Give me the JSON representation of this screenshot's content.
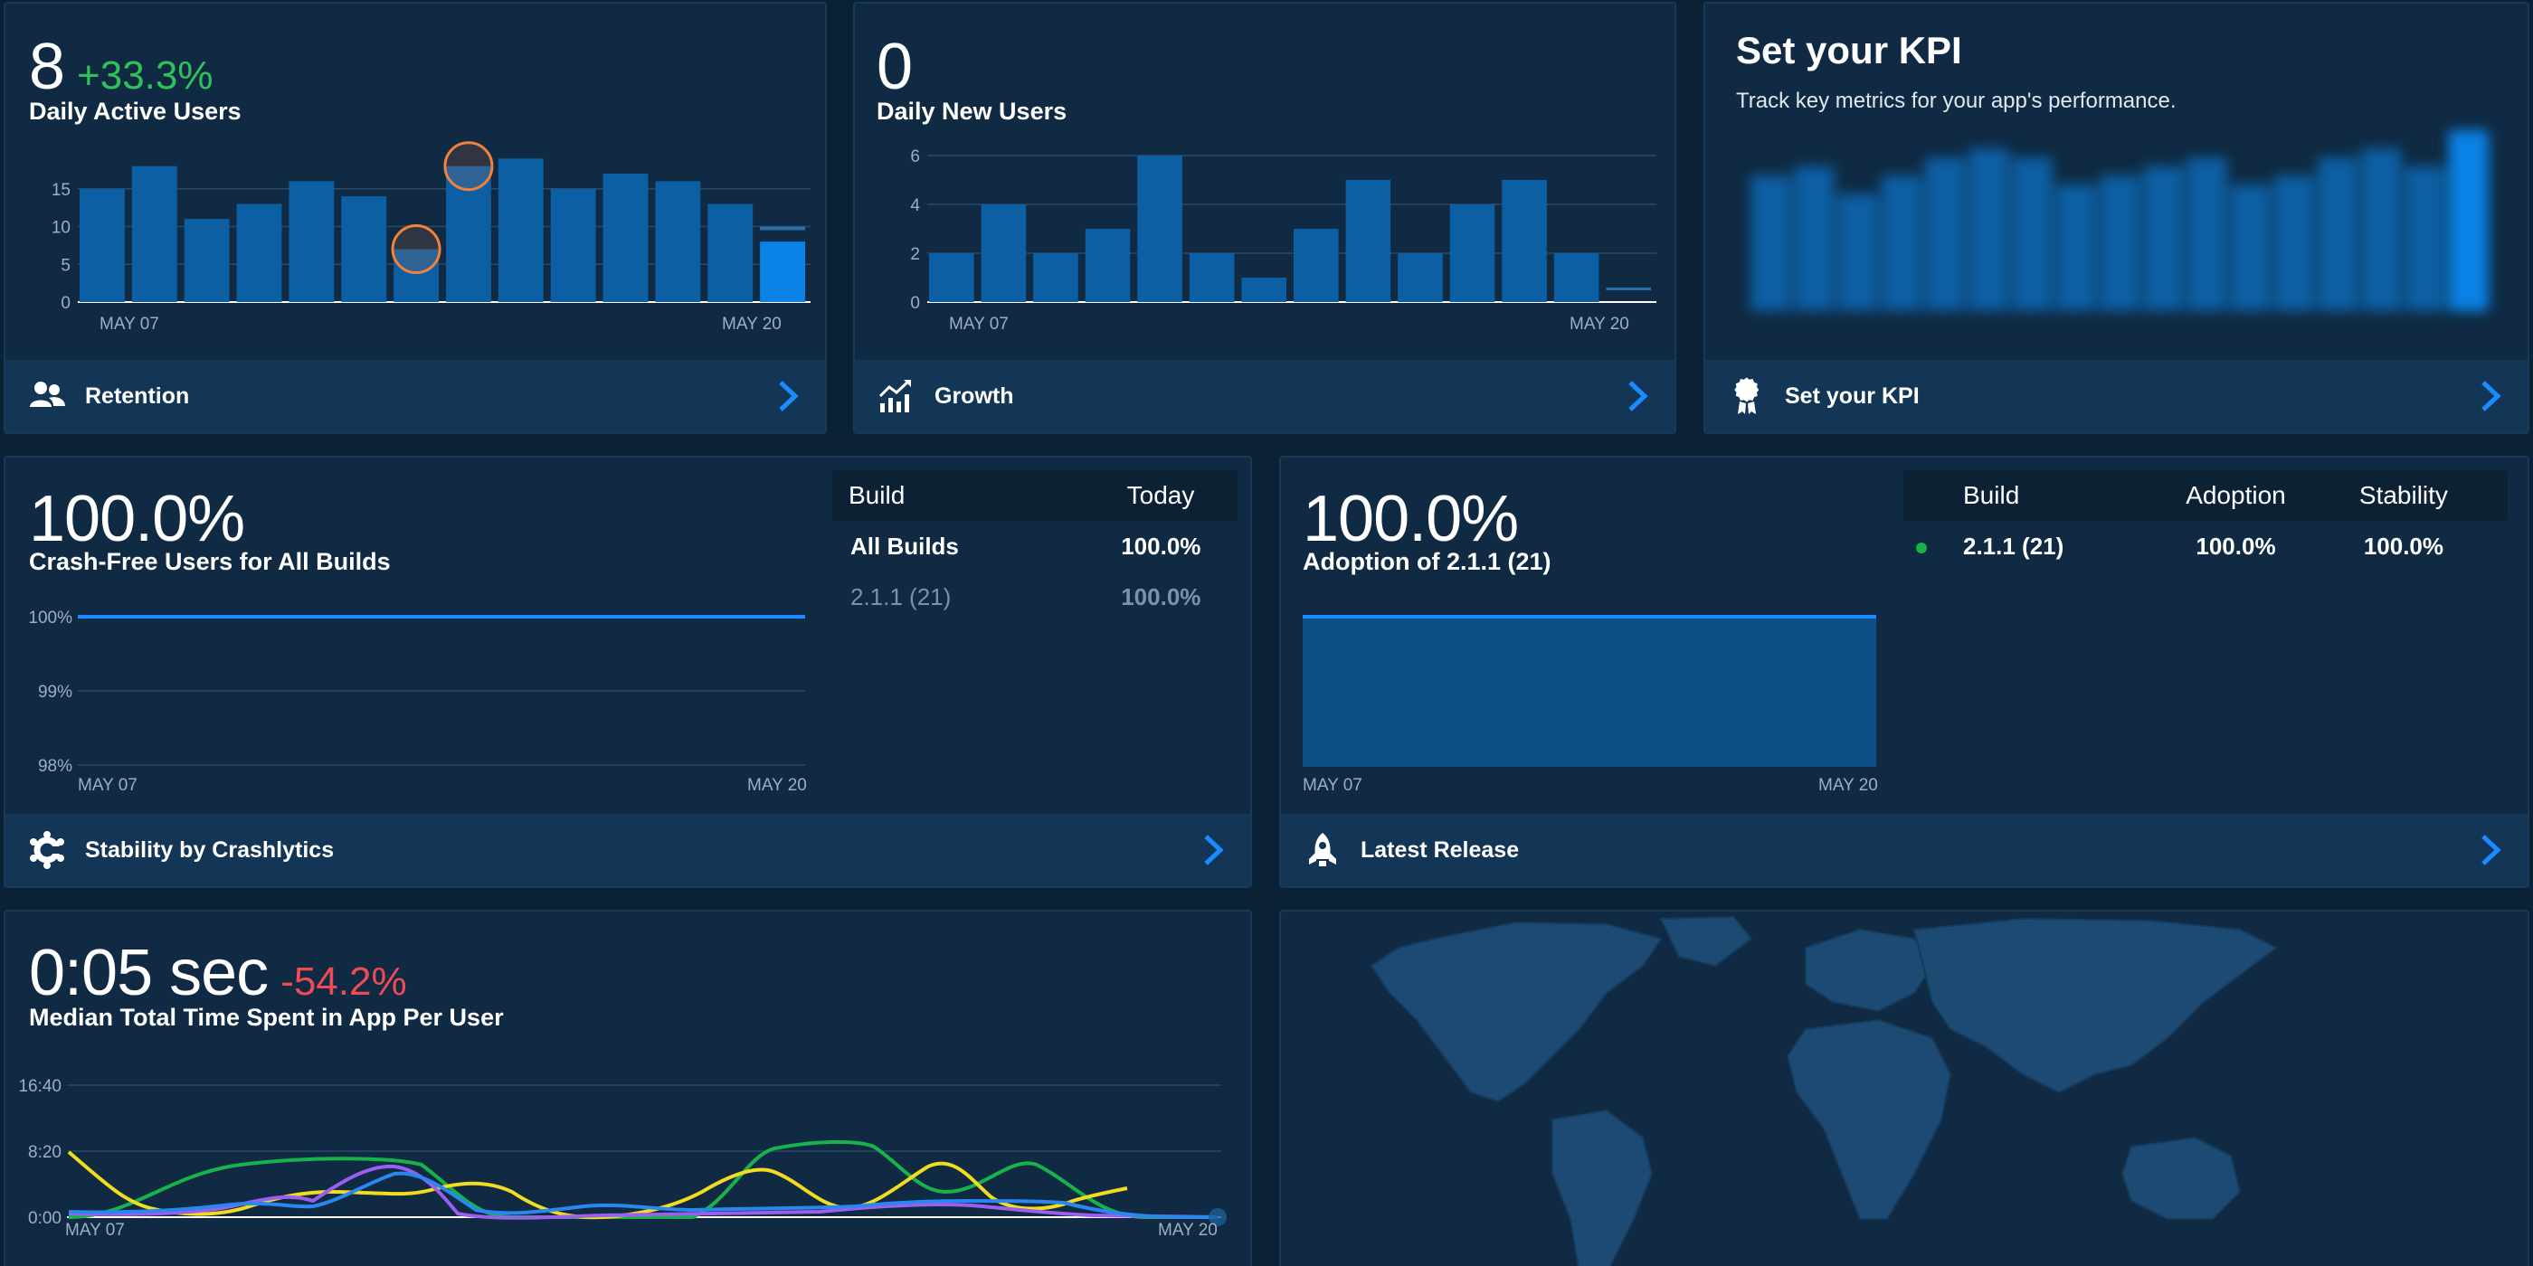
{
  "dau": {
    "value": "8",
    "delta": "+33.3%",
    "title": "Daily Active Users",
    "y_ticks": [
      "15",
      "10",
      "5",
      "0"
    ],
    "x_start": "MAY 07",
    "x_end": "MAY 20",
    "footer": "Retention"
  },
  "dnu": {
    "value": "0",
    "title": "Daily New Users",
    "y_ticks": [
      "6",
      "4",
      "2",
      "0"
    ],
    "x_start": "MAY 07",
    "x_end": "MAY 20",
    "footer": "Growth"
  },
  "kpi": {
    "title": "Set your KPI",
    "description": "Track key metrics for your app's performance.",
    "footer": "Set your KPI"
  },
  "crash": {
    "value": "100.0%",
    "title": "Crash-Free Users for All Builds",
    "y_ticks": [
      "100%",
      "99%",
      "98%"
    ],
    "x_start": "MAY 07",
    "x_end": "MAY 20",
    "table": {
      "headers": [
        "Build",
        "Today"
      ],
      "rows": [
        {
          "build": "All Builds",
          "today": "100.0%"
        },
        {
          "build": "2.1.1 (21)",
          "today": "100.0%"
        }
      ]
    },
    "footer": "Stability by Crashlytics"
  },
  "release": {
    "value": "100.0%",
    "title": "Adoption of 2.1.1 (21)",
    "x_start": "MAY 07",
    "x_end": "MAY 20",
    "table": {
      "headers": [
        "Build",
        "Adoption",
        "Stability"
      ],
      "rows": [
        {
          "build": "2.1.1 (21)",
          "adoption": "100.0%",
          "stability": "100.0%"
        }
      ]
    },
    "footer": "Latest Release"
  },
  "time": {
    "value": "0:05 sec",
    "delta": "-54.2%",
    "title": "Median Total Time Spent in App Per User",
    "y_ticks": [
      "16:40",
      "8:20",
      "0:00"
    ],
    "x_start": "MAY 07",
    "x_end": "MAY 20"
  },
  "colors": {
    "bar": "#0d5fa3",
    "bar_today": "#0a82e6",
    "accent_blue": "#1a8cff",
    "positive": "#2fc25b",
    "negative": "#ef4b55",
    "highlight": "#f0823c",
    "series_green": "#17b34a",
    "series_yellow": "#f2dc1f",
    "series_purple": "#9a5ef0",
    "series_blue": "#2b87f0"
  },
  "chart_data": [
    {
      "type": "bar",
      "title": "Daily Active Users",
      "x_range": [
        "MAY 07",
        "MAY 20"
      ],
      "values": [
        15,
        18,
        11,
        13,
        16,
        14,
        7,
        18,
        19,
        15,
        17,
        16,
        13,
        8
      ],
      "ylim": [
        0,
        20
      ],
      "grid": true
    },
    {
      "type": "bar",
      "title": "Daily New Users",
      "x_range": [
        "MAY 07",
        "MAY 20"
      ],
      "values": [
        2,
        4,
        2,
        3,
        6,
        2,
        1,
        3,
        5,
        2,
        4,
        5,
        2,
        0
      ],
      "ylim": [
        0,
        6
      ],
      "grid": true
    },
    {
      "type": "line",
      "title": "Crash-Free Users for All Builds",
      "x_range": [
        "MAY 07",
        "MAY 20"
      ],
      "values": [
        100,
        100
      ],
      "ylim": [
        98,
        100
      ]
    },
    {
      "type": "area",
      "title": "Adoption of 2.1.1 (21)",
      "x_range": [
        "MAY 07",
        "MAY 20"
      ],
      "values": [
        100,
        100
      ]
    },
    {
      "type": "line",
      "title": "Median Total Time Spent in App Per User",
      "x_range": [
        "MAY 07",
        "MAY 20"
      ],
      "ylim": [
        0,
        1000
      ]
    }
  ]
}
